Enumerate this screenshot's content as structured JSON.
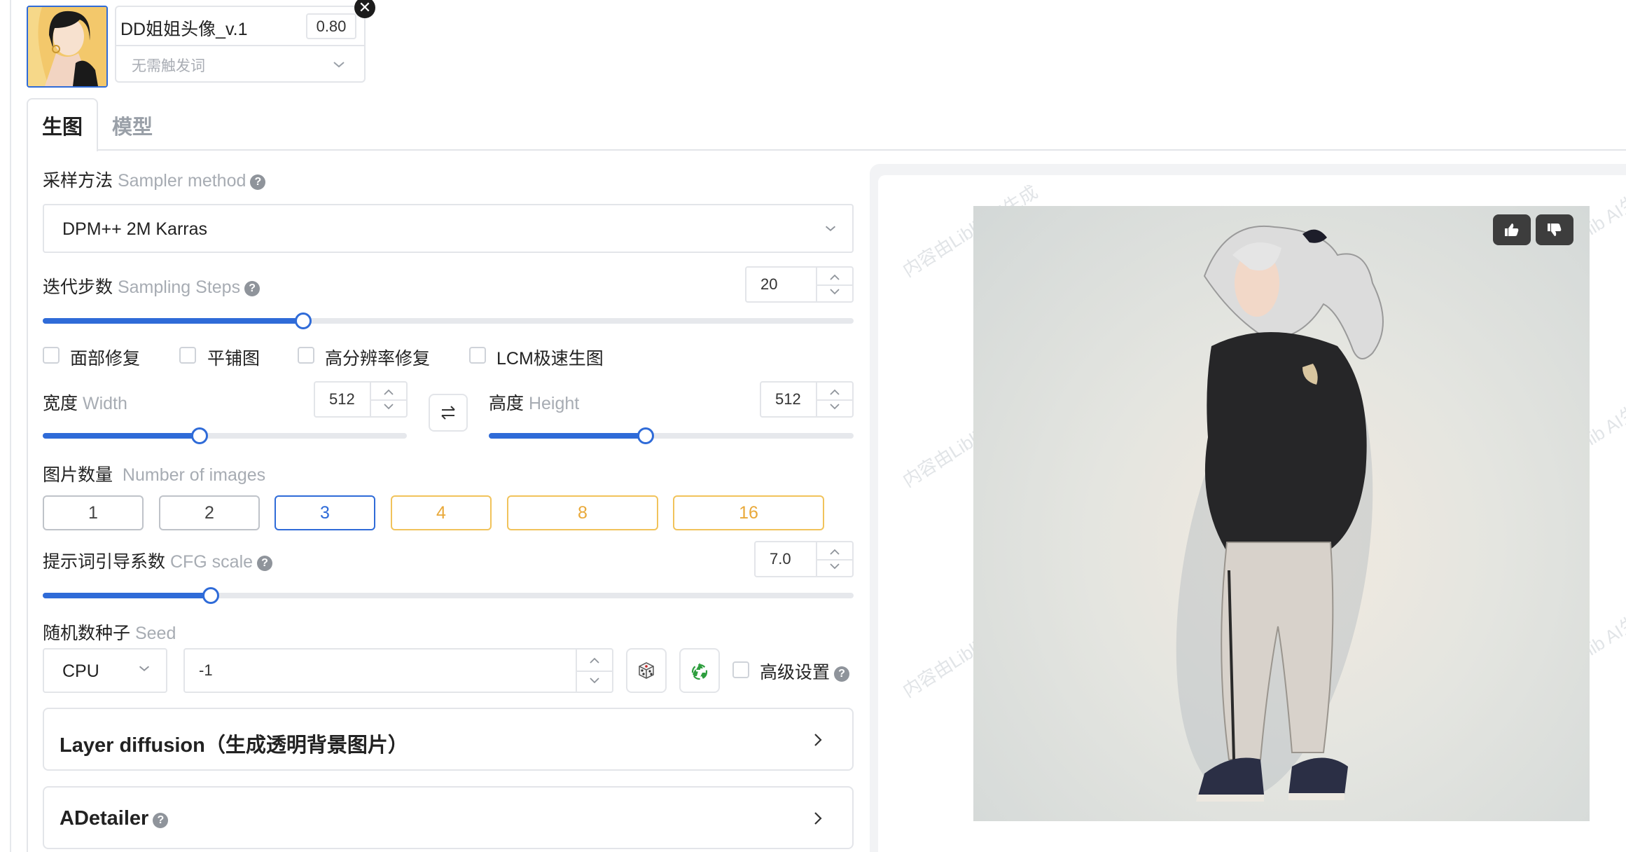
{
  "lora": {
    "name": "DD姐姐头像_v.1",
    "weight": "0.80",
    "trigger_placeholder": "无需触发词",
    "close_icon": "close-icon"
  },
  "tabs": [
    {
      "label": "生图",
      "active": true
    },
    {
      "label": "模型",
      "active": false
    }
  ],
  "sampler": {
    "label_cn": "采样方法",
    "label_en": "Sampler method",
    "value": "DPM++ 2M Karras"
  },
  "steps": {
    "label_cn": "迭代步数",
    "label_en": "Sampling Steps",
    "value": "20",
    "slider_fraction": 0.32
  },
  "options": [
    {
      "label": "面部修复",
      "checked": false
    },
    {
      "label": "平铺图",
      "checked": false
    },
    {
      "label": "高分辨率修复",
      "checked": false
    },
    {
      "label": "LCM极速生图",
      "checked": false
    }
  ],
  "width": {
    "label_cn": "宽度",
    "label_en": "Width",
    "value": "512",
    "slider_fraction": 0.43
  },
  "height": {
    "label_cn": "高度",
    "label_en": "Height",
    "value": "512",
    "slider_fraction": 0.43
  },
  "swap_icon": "swap-arrows-icon",
  "images": {
    "label_cn": "图片数量",
    "label_en": "Number of images",
    "options": [
      "1",
      "2",
      "3",
      "4",
      "8",
      "16"
    ],
    "selected": "3"
  },
  "cfg": {
    "label_cn": "提示词引导系数",
    "label_en": "CFG scale",
    "value": "7.0",
    "slider_fraction": 0.21
  },
  "seed": {
    "label_cn": "随机数种子",
    "label_en": "Seed",
    "device": "CPU",
    "value": "-1",
    "dice_icon": "dice-icon",
    "recycle_icon": "recycle-icon",
    "advanced_label": "高级设置"
  },
  "panels": {
    "layer_diffusion": "Layer diffusion（生成透明背景图片）",
    "adetailer": "ADetailer"
  },
  "preview": {
    "watermark": "内容由Liblib AI生成",
    "like_icon": "thumbs-up-icon",
    "dislike_icon": "thumbs-down-icon"
  },
  "colors": {
    "accent": "#2f6bd8",
    "gold": "#f1c35b",
    "border": "#e3e5e9"
  }
}
